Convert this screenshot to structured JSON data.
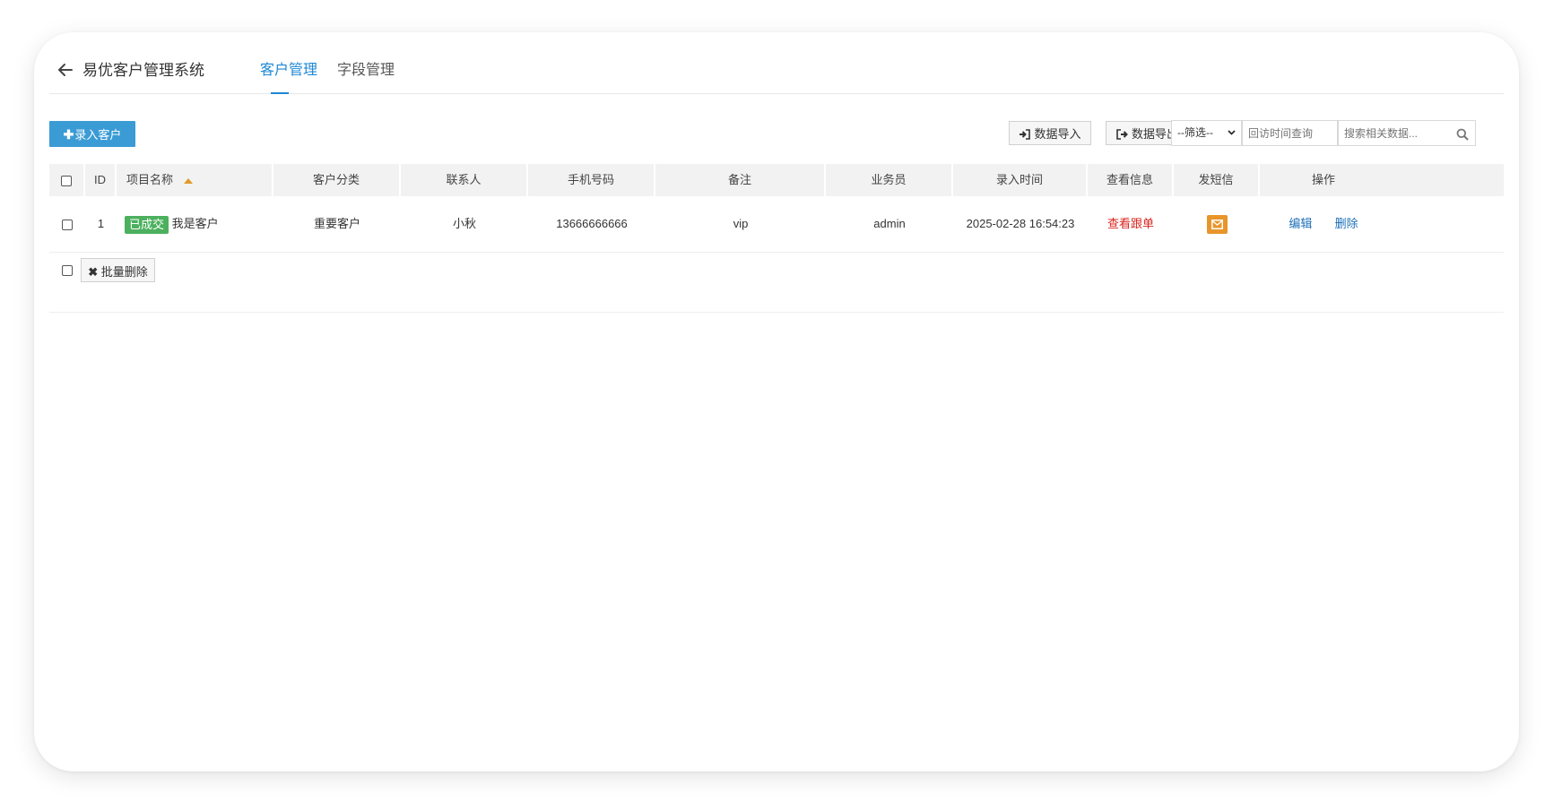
{
  "header": {
    "title": "易优客户管理系统",
    "tabs": [
      {
        "label": "客户管理",
        "active": true
      },
      {
        "label": "字段管理",
        "active": false
      }
    ]
  },
  "toolbar": {
    "add_label": "录入客户",
    "import_label": "数据导入",
    "export_label": "数据导出",
    "filter_selected": "--筛选--",
    "time_placeholder": "回访时间查询",
    "search_placeholder": "搜索相关数据..."
  },
  "table": {
    "columns": [
      "ID",
      "项目名称",
      "客户分类",
      "联系人",
      "手机号码",
      "备注",
      "业务员",
      "录入时间",
      "查看信息",
      "发短信",
      "操作"
    ],
    "rows": [
      {
        "id": "1",
        "status_badge": "已成交",
        "name": "我是客户",
        "category": "重要客户",
        "contact": "小秋",
        "phone": "13666666666",
        "remark": "vip",
        "salesman": "admin",
        "created": "2025-02-28 16:54:23",
        "view_label": "查看跟单",
        "edit_label": "编辑",
        "delete_label": "删除"
      }
    ]
  },
  "footer": {
    "batch_delete_label": "批量删除"
  },
  "colors": {
    "accent": "#1e88d4",
    "primary_button": "#3a9bd5",
    "badge_green": "#4cb05e",
    "sms_orange": "#e8952a",
    "link_red": "#d9231c",
    "link_blue": "#1c6fb8"
  }
}
